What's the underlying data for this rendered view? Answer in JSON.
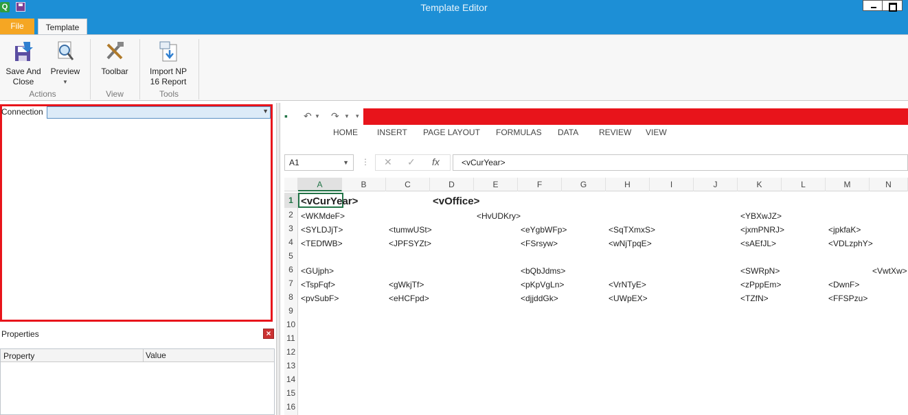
{
  "window": {
    "title": "Template Editor",
    "app_icon_glyph": "Q"
  },
  "ribbon": {
    "tabs": {
      "file": "File",
      "template": "Template"
    },
    "buttons": {
      "save_and_close": "Save And\nClose",
      "preview": "Preview",
      "toolbar": "Toolbar",
      "import_np16": "Import NP\n16 Report"
    },
    "groups": {
      "actions": "Actions",
      "view": "View",
      "tools": "Tools"
    }
  },
  "left_pane": {
    "connection_label": "Connection",
    "connection_value": "",
    "properties_title": "Properties",
    "properties_columns": {
      "property": "Property",
      "value": "Value"
    }
  },
  "excel": {
    "menu": [
      "HOME",
      "INSERT",
      "PAGE LAYOUT",
      "FORMULAS",
      "DATA",
      "REVIEW",
      "VIEW"
    ],
    "name_box": "A1",
    "formula_value": "<vCurYear>",
    "columns": [
      "A",
      "B",
      "C",
      "D",
      "E",
      "F",
      "G",
      "H",
      "I",
      "J",
      "K",
      "L",
      "M",
      "N"
    ],
    "rows": [
      "1",
      "2",
      "3",
      "4",
      "5",
      "6",
      "7",
      "8",
      "9",
      "10",
      "11",
      "12",
      "13",
      "14",
      "15",
      "16"
    ],
    "cells": {
      "r1": {
        "a": "<vCurYear>",
        "d": "<vOffice>"
      },
      "r2": {
        "a": "<WKMdeF>",
        "e": "<HvUDKry>",
        "k": "<YBXwJZ>"
      },
      "r3": {
        "a": "<SYLDJjT>",
        "c": "<tumwUSt>",
        "f": "<eYgbWFp>",
        "h": "<SqTXmxS>",
        "k": "<jxmPNRJ>",
        "m": "<jpkfaK>"
      },
      "r4": {
        "a": "<TEDfWB>",
        "c": "<JPFSYZt>",
        "f": "<FSrsyw>",
        "h": "<wNjTpqE>",
        "k": "<sAEfJL>",
        "m": "<VDLzphY>"
      },
      "r6": {
        "a": "<GUjph>",
        "f": "<bQbJdms>",
        "k": "<SWRpN>",
        "n": "<VwtXw>"
      },
      "r7": {
        "a": "<TspFqf>",
        "c": "<gWkjTf>",
        "f": "<pKpVgLn>",
        "h": "<VrNTyE>",
        "k": "<zPppEm>",
        "m": "<DwnF>"
      },
      "r8": {
        "a": "<pvSubF>",
        "c": "<eHCFpd>",
        "f": "<djjddGk>",
        "h": "<UWpEX>",
        "k": "<TZfN>",
        "m": "<FFSPzu>"
      }
    }
  },
  "colors": {
    "titlebar": "#1d8fd6",
    "file_tab": "#f5a623",
    "highlight_red": "#e8141b",
    "excel_green": "#217346"
  }
}
